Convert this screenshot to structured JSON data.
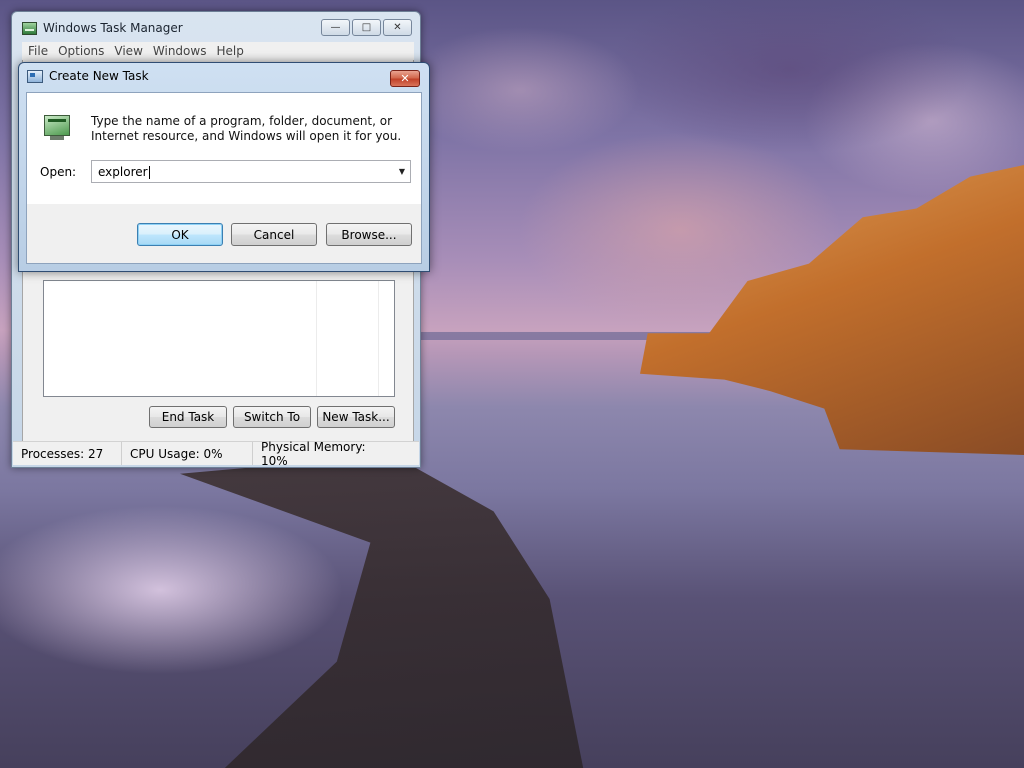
{
  "task_manager": {
    "title": "Windows Task Manager",
    "menu": [
      "File",
      "Options",
      "View",
      "Windows",
      "Help"
    ],
    "buttons": {
      "end_task": "End Task",
      "switch_to": "Switch To",
      "new_task": "New Task..."
    },
    "status": {
      "processes": "Processes: 27",
      "cpu": "CPU Usage: 0%",
      "memory": "Physical Memory: 10%"
    }
  },
  "dialog": {
    "title": "Create New Task",
    "message": "Type the name of a program, folder, document, or Internet resource, and Windows will open it for you.",
    "open_label": "Open:",
    "open_value": "explorer",
    "buttons": {
      "ok": "OK",
      "cancel": "Cancel",
      "browse": "Browse..."
    }
  },
  "icons": {
    "task_manager": "task-manager-icon",
    "run": "run-icon",
    "close": "close-icon"
  }
}
